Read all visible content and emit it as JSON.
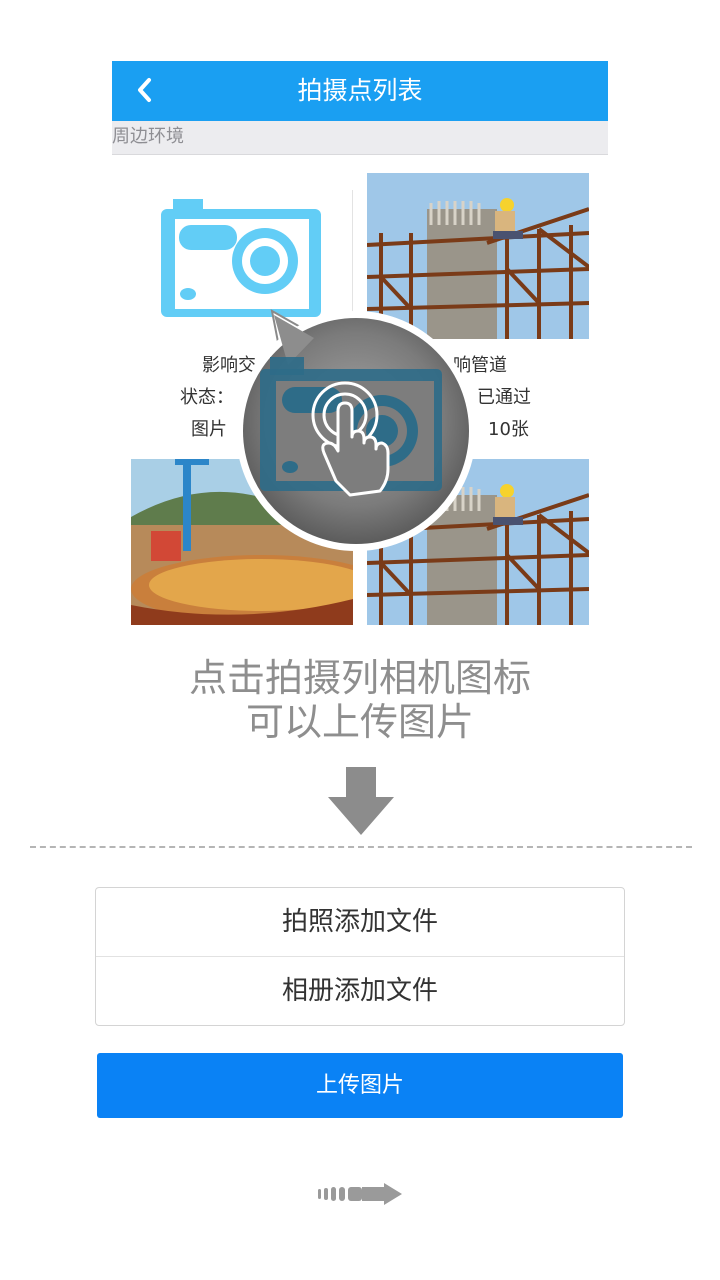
{
  "header": {
    "title": "拍摄点列表",
    "back_icon": "chevron-left-icon",
    "color": "#1a9ff2"
  },
  "section": {
    "label": "周边环境"
  },
  "grid": {
    "items": [
      {
        "name_partial": "影响交",
        "status_partial": "状态：",
        "pictures_partial": "图片"
      },
      {
        "name_partial": "响管道",
        "status_partial": "已通过",
        "pictures_partial": "10张"
      }
    ]
  },
  "instruction": {
    "line1": "点击拍摄列相机图标",
    "line2": "可以上传图片"
  },
  "sheet": {
    "option_camera": "拍照添加文件",
    "option_album": "相册添加文件"
  },
  "upload": {
    "label": "上传图片",
    "color": "#0a82f5"
  },
  "icons": {
    "camera": "camera-icon",
    "tap": "tap-hand-icon",
    "arrow_down": "arrow-down-icon",
    "swipe": "swipe-arrow-icon"
  }
}
